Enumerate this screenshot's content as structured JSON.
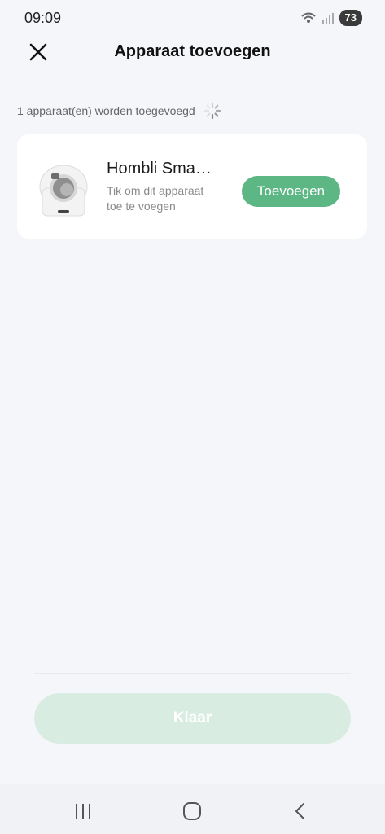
{
  "status_bar": {
    "time": "09:09",
    "battery": "73",
    "icons": [
      "wifi-icon",
      "signal-icon",
      "battery-icon"
    ]
  },
  "header": {
    "title": "Apparaat toevoegen",
    "close_icon": "close-icon"
  },
  "progress": {
    "text": "1 apparaat(en) worden toegevoegd",
    "spinner_icon": "loading-spinner-icon"
  },
  "device": {
    "name": "Hombli Sma…",
    "subtitle": "Tik om dit apparaat toe te voegen",
    "image_icon": "litter-box-device-image",
    "add_label": "Toevoegen",
    "add_color": "#5db785"
  },
  "footer": {
    "done_label": "Klaar",
    "done_color": "#d9ece2"
  },
  "nav": [
    "recent-apps-icon",
    "home-icon",
    "back-icon"
  ]
}
